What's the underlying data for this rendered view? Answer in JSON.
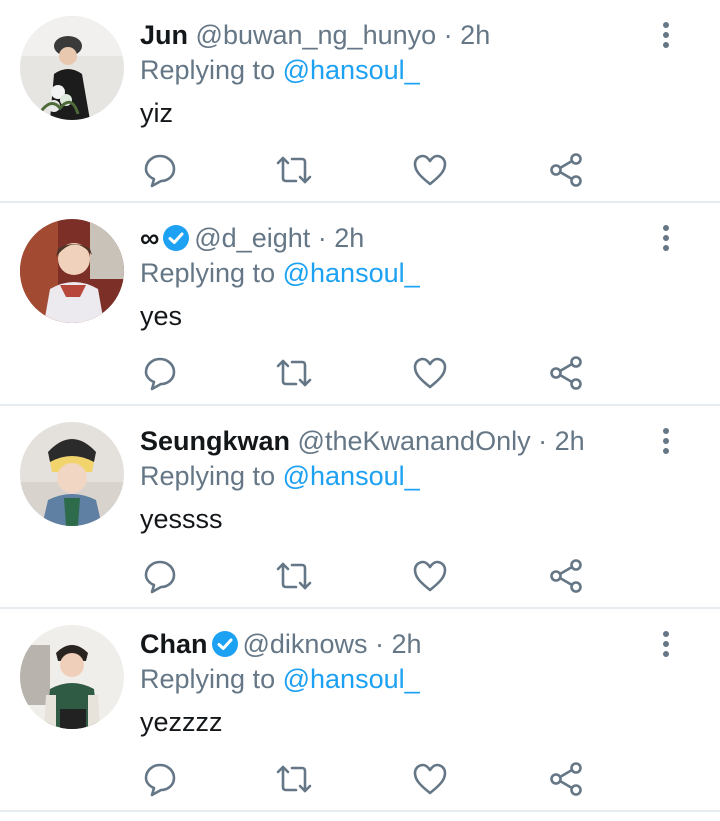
{
  "colors": {
    "accent": "#1da1f2",
    "muted": "#657786",
    "text": "#14171a",
    "divider": "#e6ecf0"
  },
  "tweets": [
    {
      "name": "Jun",
      "verified": false,
      "handle": "@buwan_ng_hunyo",
      "separator": "·",
      "time": "2h",
      "reply_prefix": "Replying to",
      "reply_to": "@hansoul_",
      "text": "yiz"
    },
    {
      "name": "∞",
      "verified": true,
      "handle": "@d_eight",
      "separator": "·",
      "time": "2h",
      "reply_prefix": "Replying to",
      "reply_to": "@hansoul_",
      "text": "yes"
    },
    {
      "name": "Seungkwan",
      "verified": false,
      "handle": "@theKwanandOnly",
      "separator": "·",
      "time": "2h",
      "reply_prefix": "Replying to",
      "reply_to": "@hansoul_",
      "text": "yessss"
    },
    {
      "name": "Chan",
      "verified": true,
      "handle": "@diknows",
      "separator": "·",
      "time": "2h",
      "reply_prefix": "Replying to",
      "reply_to": "@hansoul_",
      "text": "yezzzz"
    }
  ],
  "icons": {
    "reply": "reply-icon",
    "retweet": "retweet-icon",
    "like": "heart-icon",
    "share": "share-icon",
    "more": "more-vertical-icon",
    "verified": "verified-badge-icon"
  }
}
